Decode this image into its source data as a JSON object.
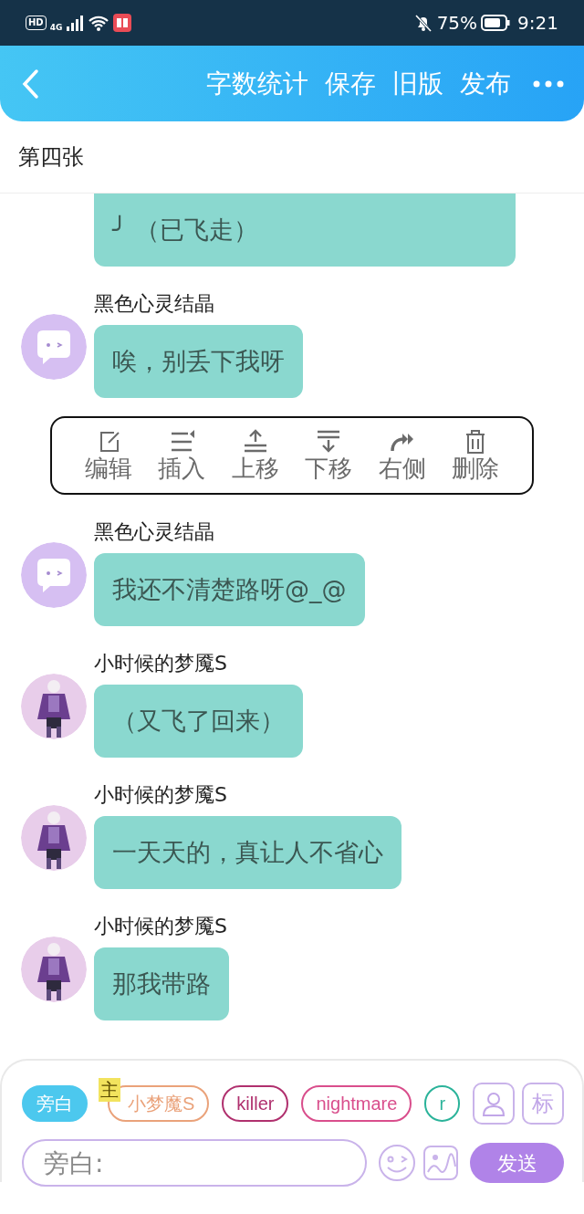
{
  "status_bar": {
    "left": [
      "HD",
      "4G"
    ],
    "battery": "75%",
    "time": "9:21"
  },
  "header": {
    "actions": [
      "字数统计",
      "保存",
      "旧版",
      "发布"
    ]
  },
  "scene_title": "第四张",
  "messages": [
    {
      "kind": "partial",
      "text": "╯ （已飞走）"
    },
    {
      "kind": "crystal",
      "name": "黑色心灵结晶",
      "text": "唉，别丢下我呀"
    },
    {
      "kind": "actions",
      "items": [
        {
          "label": "编辑"
        },
        {
          "label": "插入"
        },
        {
          "label": "上移"
        },
        {
          "label": "下移"
        },
        {
          "label": "右侧"
        },
        {
          "label": "删除"
        }
      ]
    },
    {
      "kind": "crystal",
      "name": "黑色心灵结晶",
      "text": "我还不清楚路呀@_@"
    },
    {
      "kind": "figure",
      "name": "小时候的梦魇S",
      "text": "（又飞了回来）"
    },
    {
      "kind": "figure",
      "name": "小时候的梦魇S",
      "text": "一天天的，真让人不省心"
    },
    {
      "kind": "figure",
      "name": "小时候的梦魇S",
      "text": "那我带路"
    }
  ],
  "roles": [
    {
      "label": "旁白",
      "selected": true,
      "color": "#4cc8ee"
    },
    {
      "label": "小梦魔S",
      "selected": false,
      "color": "#eaa27a",
      "badge": "主"
    },
    {
      "label": "killer",
      "selected": false,
      "color": "#b0306e"
    },
    {
      "label": "nightmare",
      "selected": false,
      "color": "#d94e8c"
    },
    {
      "label": "r",
      "selected": false,
      "color": "#2bb39a"
    }
  ],
  "tool_label": "标",
  "composer": {
    "placeholder": "旁白:",
    "send": "发送"
  }
}
